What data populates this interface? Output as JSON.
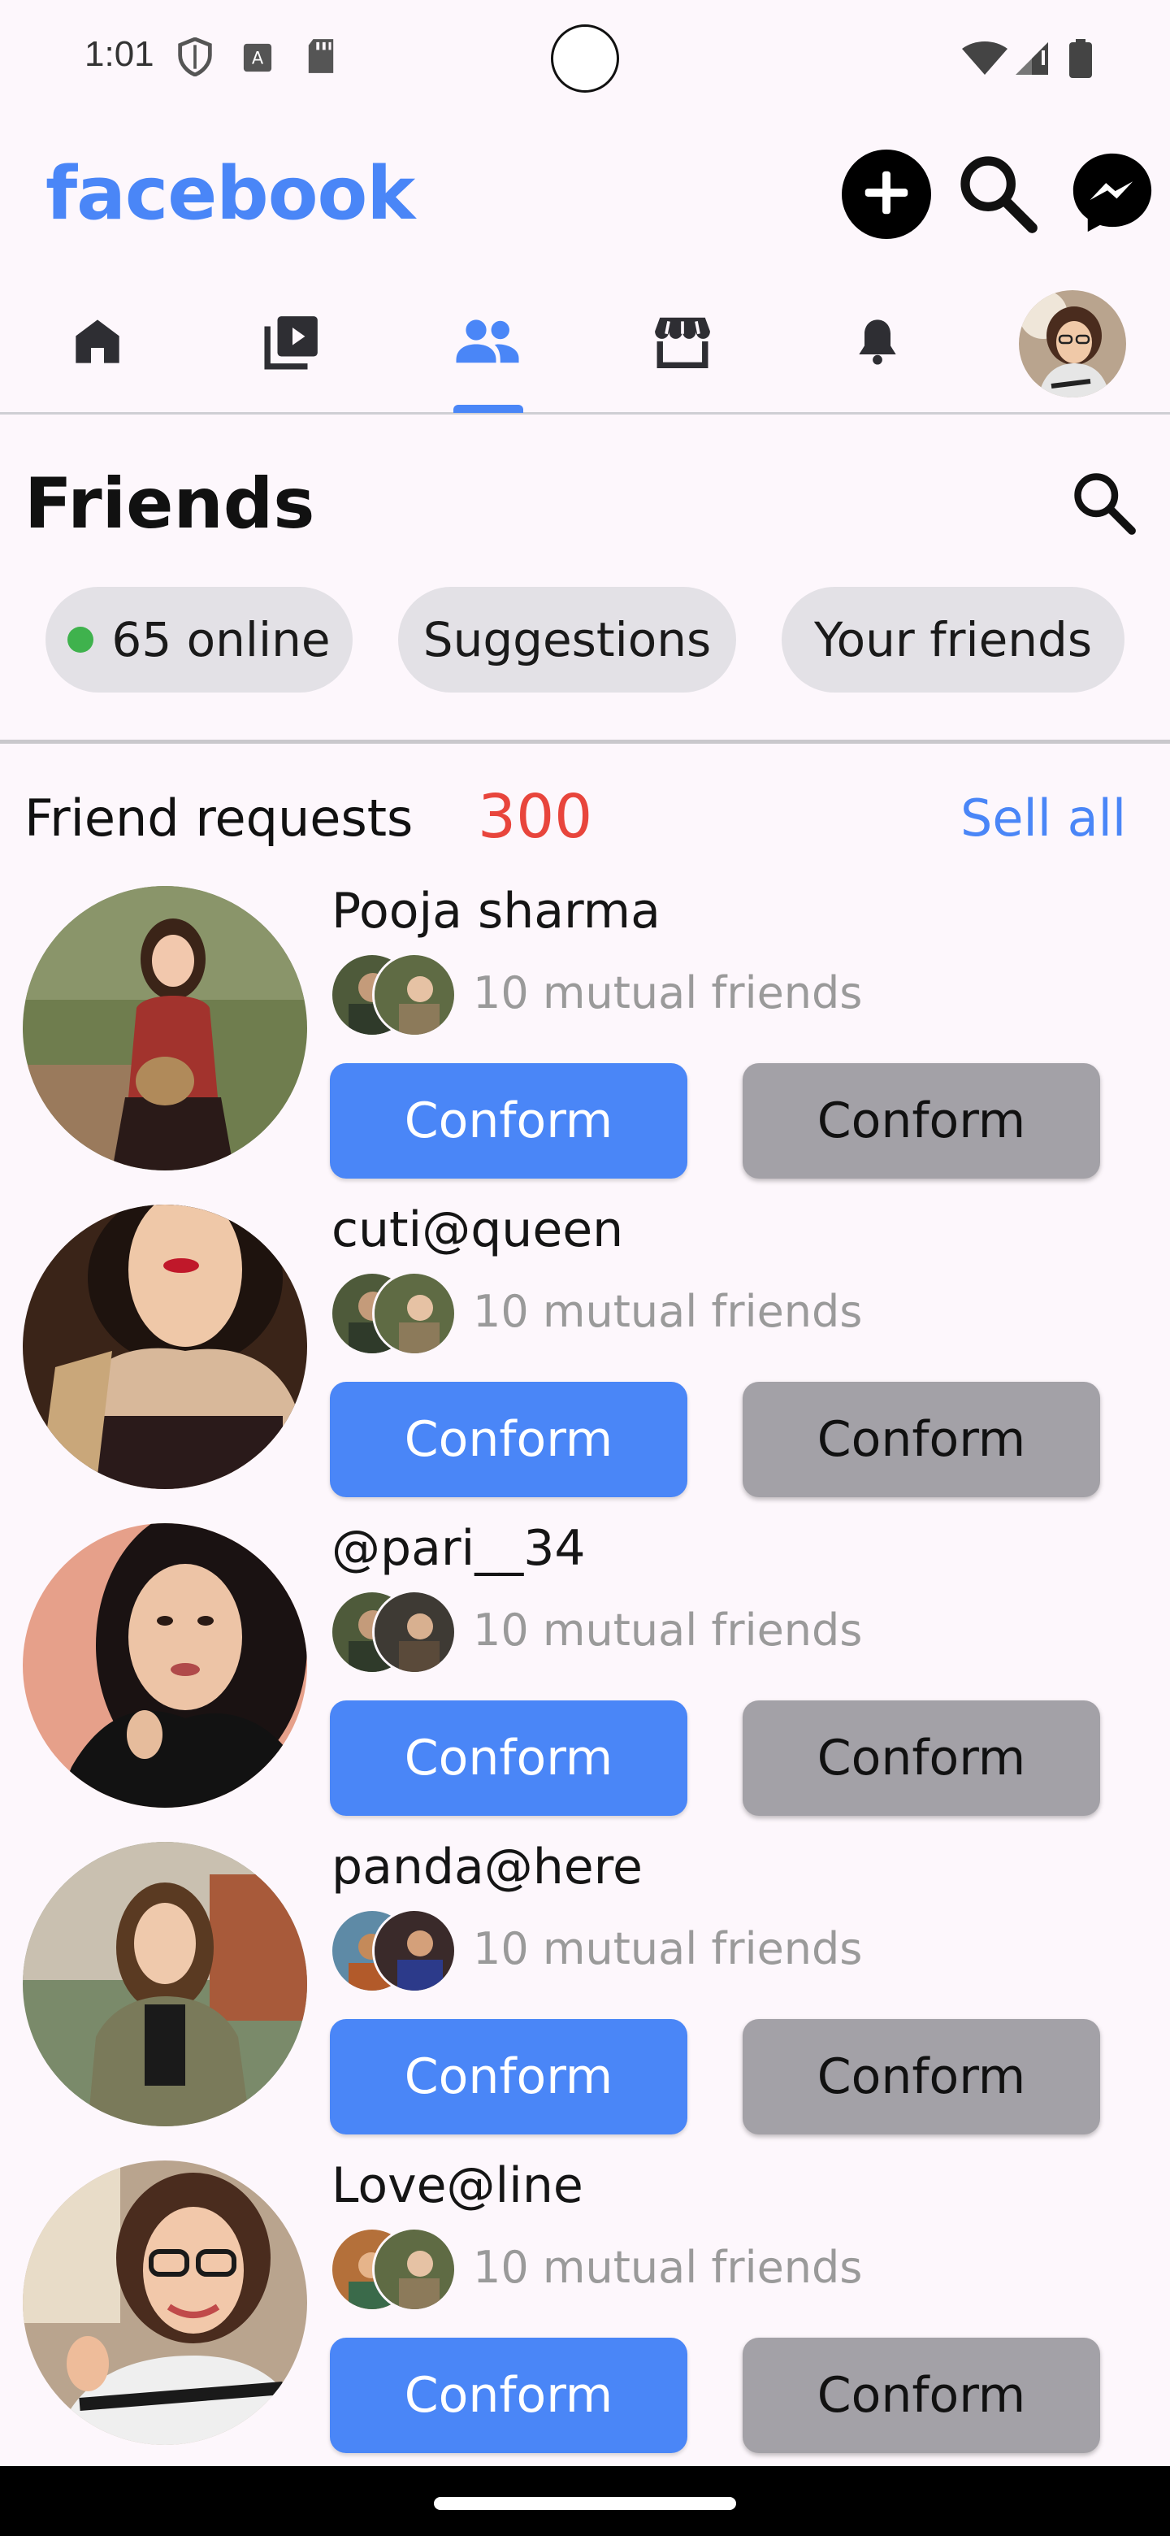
{
  "status_bar": {
    "time": "1:01",
    "icons": [
      "shield-icon",
      "keyboard-a-icon",
      "sd-card-icon",
      "wifi-icon",
      "signal-icon",
      "battery-icon"
    ]
  },
  "header": {
    "brand": "facebook",
    "brand_color": "#4a86f7",
    "actions": [
      "add-icon",
      "search-icon",
      "messenger-icon"
    ]
  },
  "nav": {
    "tabs": [
      "home-icon",
      "video-icon",
      "friends-icon",
      "marketplace-icon",
      "notifications-icon",
      "profile-avatar"
    ],
    "active_tab": "friends-icon"
  },
  "friends": {
    "title": "Friends",
    "chips": {
      "online": "65 online",
      "suggestions": "Suggestions",
      "your_friends": "Your friends"
    }
  },
  "requests": {
    "label": "Friend requests",
    "count": "300",
    "see_all": "Sell all",
    "items": [
      {
        "name": "Pooja sharma",
        "mutual": "10 mutual friends",
        "confirm": "Conform",
        "delete": "Conform"
      },
      {
        "name": "cuti@queen",
        "mutual": "10 mutual friends",
        "confirm": "Conform",
        "delete": "Conform"
      },
      {
        "name": "@pari__34",
        "mutual": "10 mutual friends",
        "confirm": "Conform",
        "delete": "Conform"
      },
      {
        "name": "panda@here",
        "mutual": "10 mutual friends",
        "confirm": "Conform",
        "delete": "Conform"
      },
      {
        "name": "Love@line",
        "mutual": "10 mutual friends",
        "confirm": "Conform",
        "delete": "Conform"
      }
    ]
  },
  "colors": {
    "accent": "#4a86f7",
    "count_red": "#e8453c",
    "online_green": "#3fb24d",
    "secondary_button": "#a3a1a7"
  }
}
